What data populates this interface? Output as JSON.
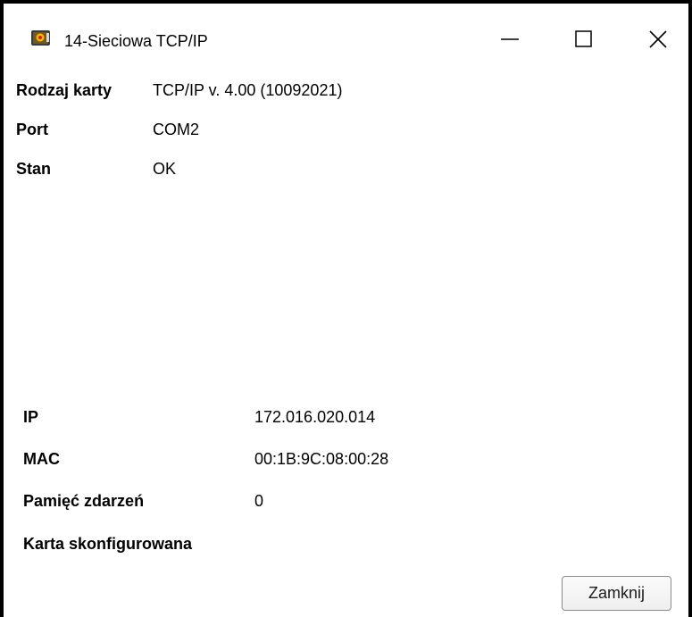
{
  "window": {
    "title": "14-Sieciowa TCP/IP",
    "icon": "app-icon",
    "controls": {
      "minimize_icon": "minimize-icon",
      "maximize_icon": "maximize-icon",
      "close_icon": "close-icon"
    }
  },
  "top_info": [
    {
      "label": "Rodzaj karty",
      "value": "TCP/IP v. 4.00 (10092021)"
    },
    {
      "label": "Port",
      "value": "COM2"
    },
    {
      "label": "Stan",
      "value": "OK"
    }
  ],
  "network_info": [
    {
      "label": "IP",
      "value": "172.016.020.014"
    },
    {
      "label": "MAC",
      "value": "00:1B:9C:08:00:28"
    },
    {
      "label": "Pamięć zdarzeń",
      "value": "0"
    }
  ],
  "config_status": "Karta skonfigurowana",
  "close_button_label": "Zamknij"
}
